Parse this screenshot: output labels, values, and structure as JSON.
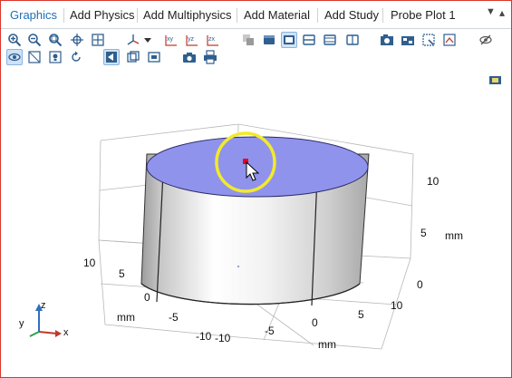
{
  "tabs": [
    {
      "label": "Graphics",
      "active": true
    },
    {
      "label": "Add Physics"
    },
    {
      "label": "Add Multiphysics"
    },
    {
      "label": "Add Material"
    },
    {
      "label": "Add Study"
    },
    {
      "label": "Probe Plot 1"
    }
  ],
  "tab_controls": {
    "menu_icon": "dropdown-arrow-icon",
    "pin_icon": "pin-icon"
  },
  "toolbar_row1": [
    "zoom-in-icon",
    "zoom-out-icon",
    "zoom-box-icon",
    "zoom-selected-icon",
    "zoom-extents-icon",
    "view-axes-dropdown-icon",
    "go-to-xy-view-icon",
    "go-to-yz-view-icon",
    "go-to-zx-view-icon",
    "select-objects-icon",
    "select-domains-icon",
    "select-boundaries-icon",
    "select-edges-icon",
    "select-points-icon",
    "clear-selection-icon",
    "image-snapshot-icon",
    "transparency-icon",
    "show-grid-icon",
    "hide-icon"
  ],
  "toolbar_row2": [
    "view-icon",
    "wireframe-icon",
    "scene-light-icon",
    "reset-view-icon",
    "boundary-select-icon",
    "domain-select-icon",
    "box-select-icon",
    "camera-icon",
    "print-icon"
  ],
  "axes": {
    "x_ticks": [
      "-10",
      "-5",
      "0",
      "5",
      "10"
    ],
    "y_ticks": [
      "-10",
      "-5",
      "0",
      "5",
      "10"
    ],
    "z_ticks": [
      "0",
      "5",
      "10"
    ],
    "x_unit": "mm",
    "y_unit": "mm",
    "z_unit": "mm"
  },
  "triad": {
    "x": "x",
    "y": "y",
    "z": "z"
  },
  "colors": {
    "top_face": "#8f93ec",
    "highlight_ring": "#f3ea2a",
    "point_marker": "#e8001b",
    "active_tab": "#1d6fb8",
    "frame_border": "#d9342b"
  }
}
